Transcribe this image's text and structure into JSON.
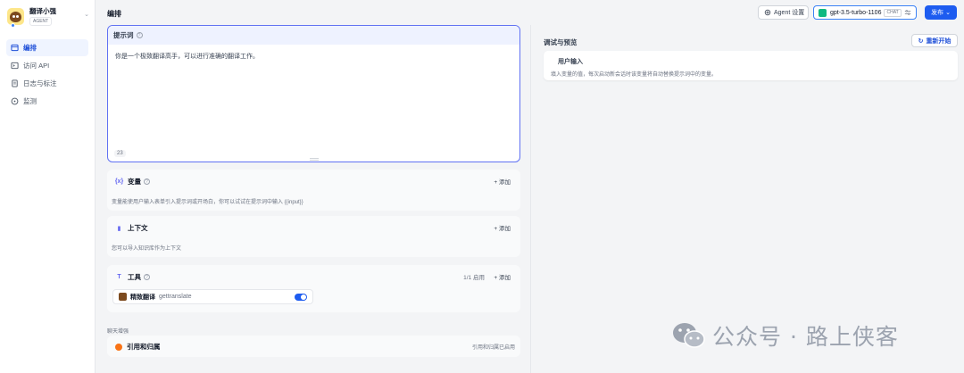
{
  "app": {
    "name": "翻译小强",
    "badge": "AGENT"
  },
  "nav": {
    "items": [
      {
        "label": "编排",
        "icon": "layout-icon",
        "active": true
      },
      {
        "label": "访问 API",
        "icon": "terminal-icon",
        "active": false
      },
      {
        "label": "日志与标注",
        "icon": "document-icon",
        "active": false
      },
      {
        "label": "监测",
        "icon": "monitor-icon",
        "active": false
      }
    ]
  },
  "header": {
    "title": "编排",
    "agent_settings": "Agent 设置",
    "model": {
      "name": "gpt-3.5-turbo-1106",
      "tag": "CHAT"
    },
    "publish": "发布"
  },
  "prompt": {
    "title": "提示词",
    "text": "你是一个极致翻译高手，可以进行准确的翻译工作。",
    "count": "23"
  },
  "sections": {
    "variables": {
      "title": "变量",
      "add": "+ 添加",
      "desc": "变量能使用户输入表单引入提示词或开场白，你可以试试在提示词中输入 {{input}}"
    },
    "context": {
      "title": "上下文",
      "add": "+ 添加",
      "desc": "您可以导入知识库作为上下文"
    },
    "tools": {
      "title": "工具",
      "add": "+ 添加",
      "count": "1/1 启用",
      "items": [
        {
          "name": "精致翻译",
          "sub": "gettranslate",
          "enabled": true
        }
      ]
    },
    "enhance_label": "聊天增强",
    "citation": {
      "title": "引用和归属",
      "status": "引用和归属已启用"
    }
  },
  "preview": {
    "title": "调试与预览",
    "restart": "重新开始",
    "user_input": {
      "title": "用户输入",
      "desc": "填入变量的值，每次启动新会话时该变量将自动替换提示词中的变量。"
    }
  },
  "watermark": "公众号 · 路上侠客",
  "colors": {
    "accent": "#1d5cf0",
    "prompt_border": "#6172f3",
    "model_icon": "#10b981",
    "citation": "#f97316"
  }
}
